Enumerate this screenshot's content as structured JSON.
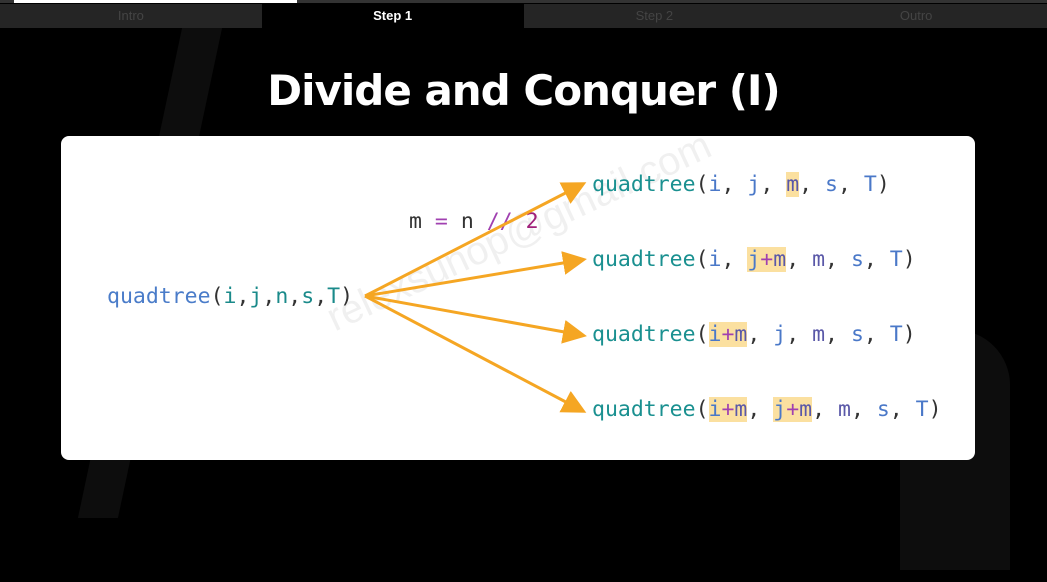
{
  "progress": {
    "value": 0.27
  },
  "tabs": [
    {
      "label": "Intro"
    },
    {
      "label": "Step 1"
    },
    {
      "label": "Step 2"
    },
    {
      "label": "Outro"
    }
  ],
  "title": "Divide and Conquer (I)",
  "watermark": "relexsunop@gmail.com",
  "source": {
    "fn": "quadtree",
    "open": "(",
    "a1": "i",
    ",": ",",
    "a2": "j",
    "a3": "n",
    "a4": "s",
    "a5": "T",
    "close": ")"
  },
  "split": {
    "lhs": "m",
    "eq": "=",
    "rhs": "n",
    "op": "//",
    "num": "2"
  },
  "calls": [
    {
      "fn": "quadtree",
      "args": [
        "i",
        "j",
        "m",
        "s",
        "T"
      ]
    },
    {
      "fn": "quadtree",
      "args": [
        "i",
        "j+m",
        "m",
        "s",
        "T"
      ]
    },
    {
      "fn": "quadtree",
      "args": [
        "i+m",
        "j",
        "m",
        "s",
        "T"
      ]
    },
    {
      "fn": "quadtree",
      "args": [
        "i+m",
        "j+m",
        "m",
        "s",
        "T"
      ]
    }
  ],
  "colors": {
    "arrow": "#f5a623",
    "highlight": "#fbe0a0"
  }
}
